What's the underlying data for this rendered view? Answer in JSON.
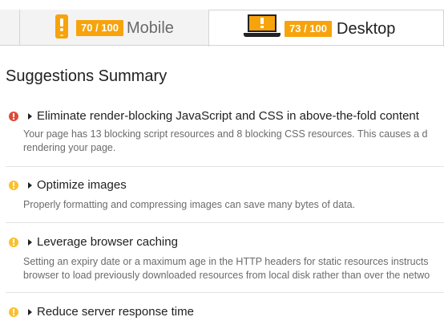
{
  "tabs": [
    {
      "label": "Mobile",
      "score": "70 / 100",
      "icon": "mobile-phone-icon",
      "active": false
    },
    {
      "label": "Desktop",
      "score": "73 / 100",
      "icon": "desktop-laptop-icon",
      "active": true
    }
  ],
  "colors": {
    "score_badge": "#f7a30b",
    "error": "#dd4b39",
    "warning": "#fbc02d"
  },
  "summary": {
    "title": "Suggestions Summary",
    "items": [
      {
        "severity": "error",
        "icon": "exclamation-circle-icon",
        "title": "Eliminate render-blocking JavaScript and CSS in above-the-fold content",
        "description": [
          "Your page has 13 blocking script resources and 8 blocking CSS resources. This causes a d",
          "rendering your page."
        ]
      },
      {
        "severity": "warning",
        "icon": "exclamation-circle-icon",
        "title": "Optimize images",
        "description": [
          "Properly formatting and compressing images can save many bytes of data."
        ]
      },
      {
        "severity": "warning",
        "icon": "exclamation-circle-icon",
        "title": "Leverage browser caching",
        "description": [
          "Setting an expiry date or a maximum age in the HTTP headers for static resources instructs",
          "browser to load previously downloaded resources from local disk rather than over the netwo"
        ]
      },
      {
        "severity": "warning",
        "icon": "exclamation-circle-icon",
        "title": "Reduce server response time",
        "description": []
      }
    ]
  }
}
